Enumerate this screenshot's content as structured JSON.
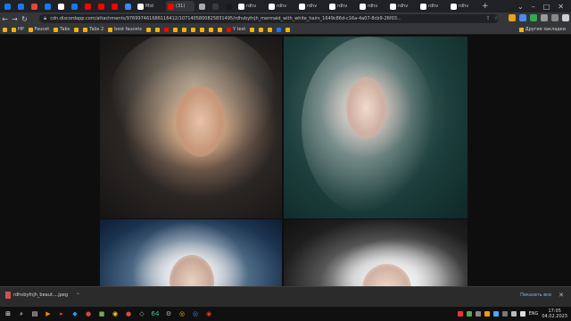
{
  "browser": {
    "tabs": [
      {
        "label": "",
        "color": "#1877f2"
      },
      {
        "label": "",
        "color": "#1877f2"
      },
      {
        "label": "",
        "color": "#e8453c"
      },
      {
        "label": "",
        "color": "#1877f2"
      },
      {
        "label": "",
        "color": "#ffffff"
      },
      {
        "label": "",
        "color": "#1877f2"
      },
      {
        "label": "",
        "color": "#ff0000"
      },
      {
        "label": "",
        "color": "#ff0000"
      },
      {
        "label": "",
        "color": "#ff0000"
      },
      {
        "label": "",
        "color": "#4285f4"
      },
      {
        "label": "Mid",
        "color": "#ffffff"
      },
      {
        "label": "(31)",
        "color": "#ff0000"
      },
      {
        "label": "",
        "color": "#aaaaaa"
      },
      {
        "label": "",
        "color": "#3b3b3b"
      },
      {
        "label": "",
        "color": "#1a1a1a"
      },
      {
        "label": "rdhv",
        "color": "#ffffff"
      },
      {
        "label": "rdhv",
        "color": "#ffffff"
      },
      {
        "label": "rdhv",
        "color": "#ffffff"
      },
      {
        "label": "rdhv",
        "color": "#ffffff"
      },
      {
        "label": "rdhv",
        "color": "#ffffff"
      },
      {
        "label": "rdhv",
        "color": "#ffffff"
      },
      {
        "label": "rdhv",
        "color": "#ffffff"
      },
      {
        "label": "rdhv",
        "color": "#ffffff"
      }
    ],
    "new_tab": "+",
    "window_controls": {
      "minimize": "–",
      "maximize": "□",
      "close": "✕",
      "chevron": "⌄"
    },
    "nav": {
      "back": "←",
      "forward": "→",
      "reload": "↻"
    },
    "url": "cdn.discordapp.com/attachments/976997461686116412/1071405800825831495/rdhvbyfnjh_mermaid_with_white_hairs_1649c86d-c16a-4a07-8cb9-26f03...",
    "omnibox_icons": {
      "share": "⇪",
      "star": "☆"
    },
    "extensions": [
      "#e6a21c",
      "#4c8bf5",
      "#34a853",
      "#9a9a9a",
      "#888888",
      "#cfcfcf"
    ],
    "bookmarks": [
      {
        "label": "",
        "color": "#f4b400"
      },
      {
        "label": "HP",
        "color": "#f4b400"
      },
      {
        "label": "Faucet",
        "color": "#f4b400"
      },
      {
        "label": "Tabs",
        "color": "#f4b400"
      },
      {
        "label": "",
        "color": "#f4b400"
      },
      {
        "label": "Tabs 2",
        "color": "#f4b400"
      },
      {
        "label": "best faucets",
        "color": "#f4b400"
      },
      {
        "label": "",
        "color": "#f4b400"
      },
      {
        "label": "",
        "color": "#f4b400"
      },
      {
        "label": "",
        "color": "#ff0000"
      },
      {
        "label": "",
        "color": "#f4b400"
      },
      {
        "label": "",
        "color": "#f4b400"
      },
      {
        "label": "",
        "color": "#f4b400"
      },
      {
        "label": "",
        "color": "#f4b400"
      },
      {
        "label": "",
        "color": "#f4b400"
      },
      {
        "label": "",
        "color": "#f4b400"
      },
      {
        "label": "Y test",
        "color": "#ff0000"
      },
      {
        "label": "",
        "color": "#f0b90b"
      },
      {
        "label": "",
        "color": "#f4b400"
      },
      {
        "label": "",
        "color": "#f4b400"
      },
      {
        "label": "",
        "color": "#1877f2"
      },
      {
        "label": "",
        "color": "#f4b400"
      }
    ],
    "other_bookmarks": "Другие закладки"
  },
  "download_bar": {
    "filename": "rdhvbyfnjh_beaut....jpeg",
    "chevron": "⌃",
    "show_all": "Показать все",
    "close": "✕"
  },
  "taskbar": {
    "apps": [
      {
        "glyph": "⊞",
        "color": "#ffffff"
      },
      {
        "glyph": "⌕",
        "color": "#ffffff"
      },
      {
        "glyph": "▤",
        "color": "#ffffff"
      },
      {
        "glyph": "▶",
        "color": "#e88a1a"
      },
      {
        "glyph": "▸",
        "color": "#e44"
      },
      {
        "glyph": "◆",
        "color": "#1da1f2"
      },
      {
        "glyph": "●",
        "color": "#d44"
      },
      {
        "glyph": "■",
        "color": "#7a5"
      },
      {
        "glyph": "◉",
        "color": "#ffd400"
      },
      {
        "glyph": "●",
        "color": "#e6453c"
      },
      {
        "glyph": "◇",
        "color": "#bbb"
      },
      {
        "glyph": "64",
        "color": "#3c8"
      },
      {
        "glyph": "⚙",
        "color": "#aaa"
      },
      {
        "glyph": "◎",
        "color": "#fbbc05"
      },
      {
        "glyph": "◎",
        "color": "#4285f4"
      },
      {
        "glyph": "◉",
        "color": "#e33"
      }
    ],
    "tray_icons": [
      "#e33",
      "#5a5",
      "#888",
      "#f90",
      "#4af",
      "#777",
      "#bbb",
      "#ddd"
    ],
    "lang": "ENG",
    "time": "17:05",
    "date": "04.02.2023"
  }
}
